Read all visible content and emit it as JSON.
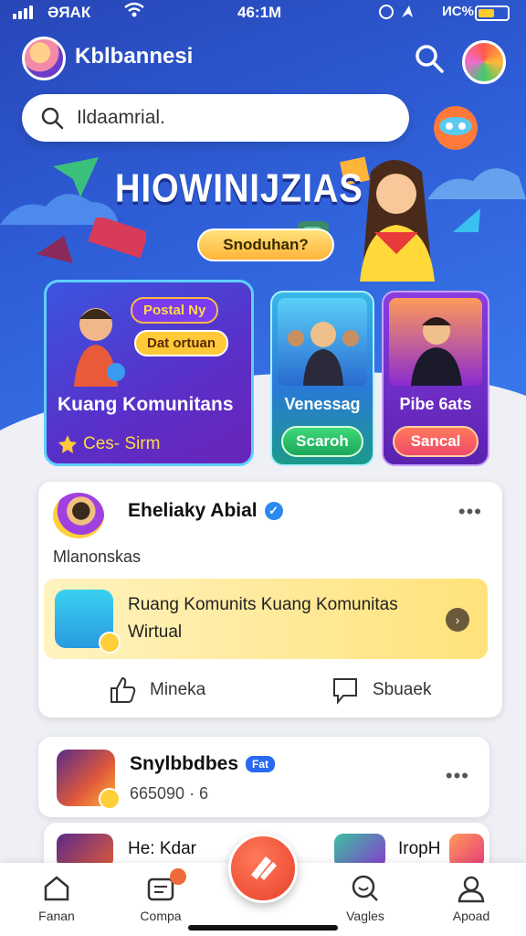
{
  "status_bar": {
    "carrier": "ƏЯАК",
    "time": "46:1M",
    "battery_text": "ИС%",
    "battery_level": 0.55
  },
  "header": {
    "app_title": "Kblbannesi",
    "search_placeholder": "Ildaamrial."
  },
  "hero": {
    "title": "HIOWINIJZIAS",
    "button_label": "Snoduhan?"
  },
  "categories": {
    "main": {
      "tag1": "Postal Ny",
      "tag2": "Dat ortuan",
      "title": "Kuang Komunitans",
      "subtitle": "Ces- Sirm"
    },
    "cards": [
      {
        "label": "Venessag",
        "button": "Scaroh"
      },
      {
        "label": "Pibe 6ats",
        "button": "Sancal"
      }
    ]
  },
  "post": {
    "author": "Eheliaky Abial",
    "caption": "Mlanonskas",
    "embed_text": "Ruang Komunits Kuang Komunitas Wirtual",
    "like_label": "Mineka",
    "share_label": "Sbuaek"
  },
  "post2": {
    "author": "Snylbbdbes",
    "badge": "Fat",
    "meta": "665090 · 6"
  },
  "post3": {
    "text1": "He: Kdar",
    "text2": "IropH"
  },
  "nav": {
    "items": [
      {
        "label": "Fanan",
        "icon": "home-icon"
      },
      {
        "label": "Compa",
        "icon": "compose-icon"
      },
      {
        "label": "Vagles",
        "icon": "smile-search-icon"
      },
      {
        "label": "Apoad",
        "icon": "profile-icon"
      }
    ]
  },
  "colors": {
    "hero_blue": "#2f5fd8",
    "accent_orange": "#e8402a",
    "accent_yellow": "#ffc93a"
  }
}
